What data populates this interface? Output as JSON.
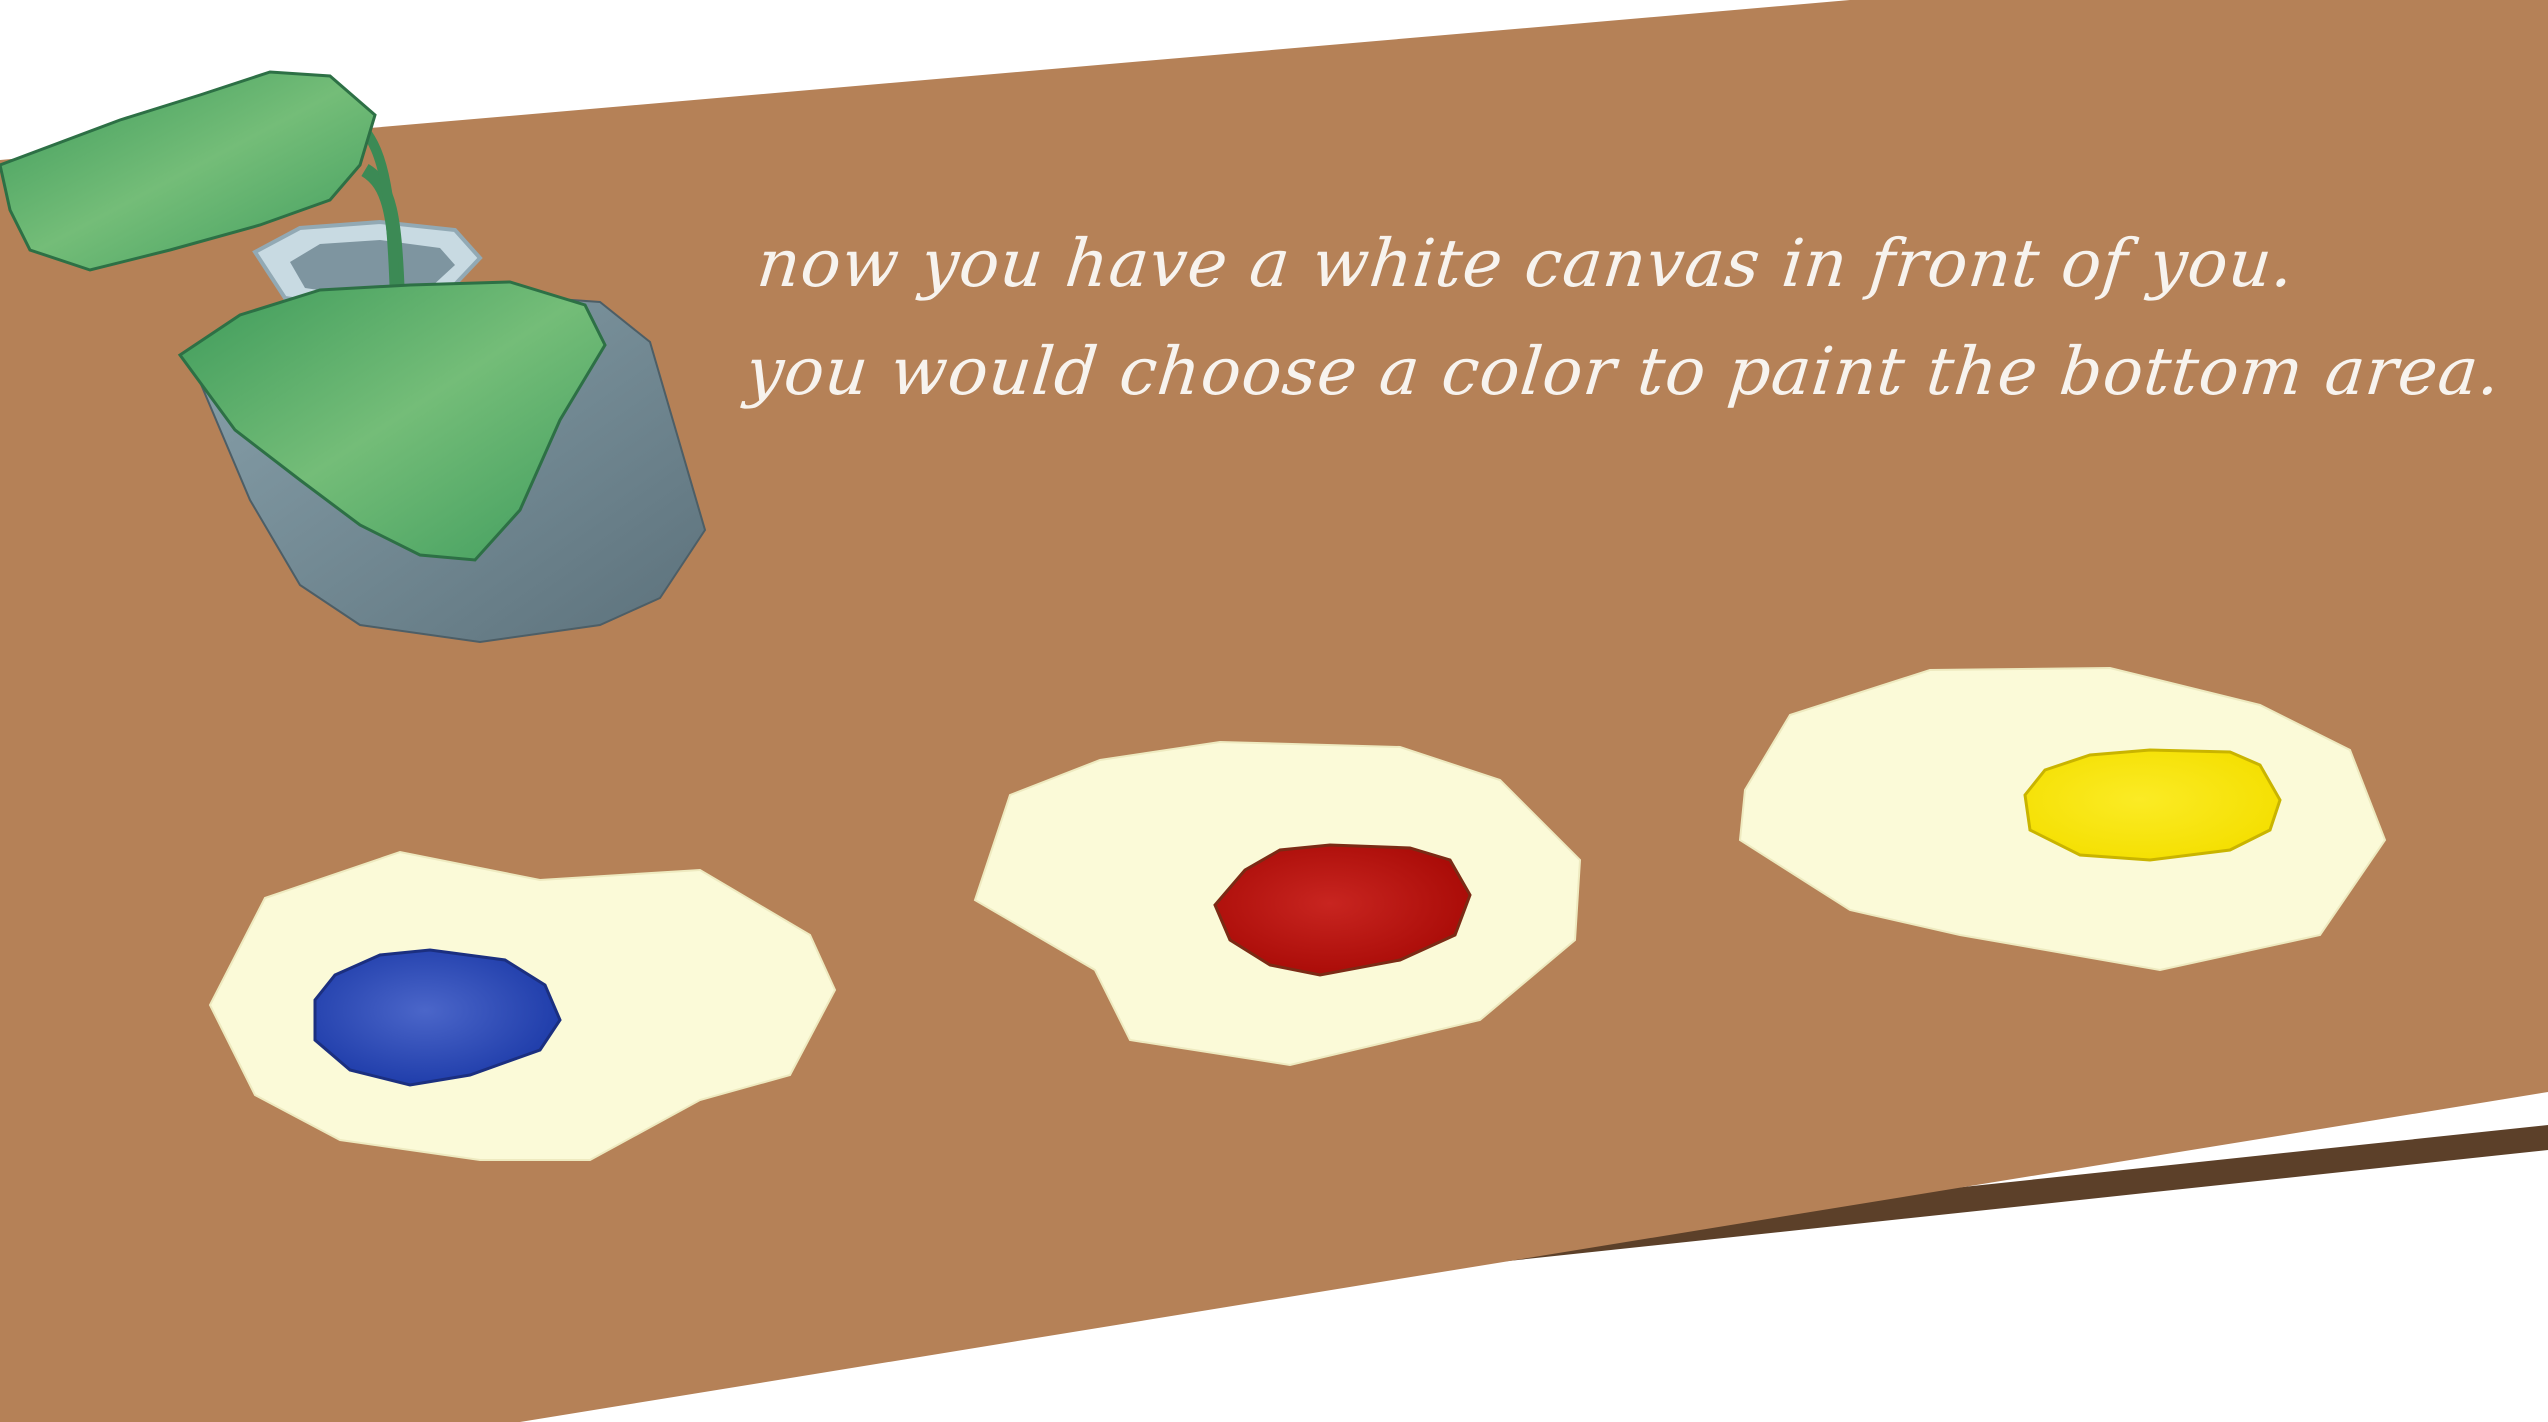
{
  "scene": {
    "narration": {
      "line1": "now you have a white canvas in front of you.",
      "line2": "you would choose a color to paint the bottom area."
    },
    "paints": [
      {
        "id": "blue",
        "color": "#2e4fbc"
      },
      {
        "id": "red",
        "color": "#bd0d0a"
      },
      {
        "id": "yellow",
        "color": "#f7e40a"
      }
    ],
    "colors": {
      "table_top": "#b58157",
      "table_edge": "#5c4029",
      "palette": "#fbfad8",
      "plant_pot": "#647a84",
      "leaf": "#4aa866",
      "text": "#f7f3ee"
    },
    "icons": [
      "plant-icon"
    ]
  }
}
